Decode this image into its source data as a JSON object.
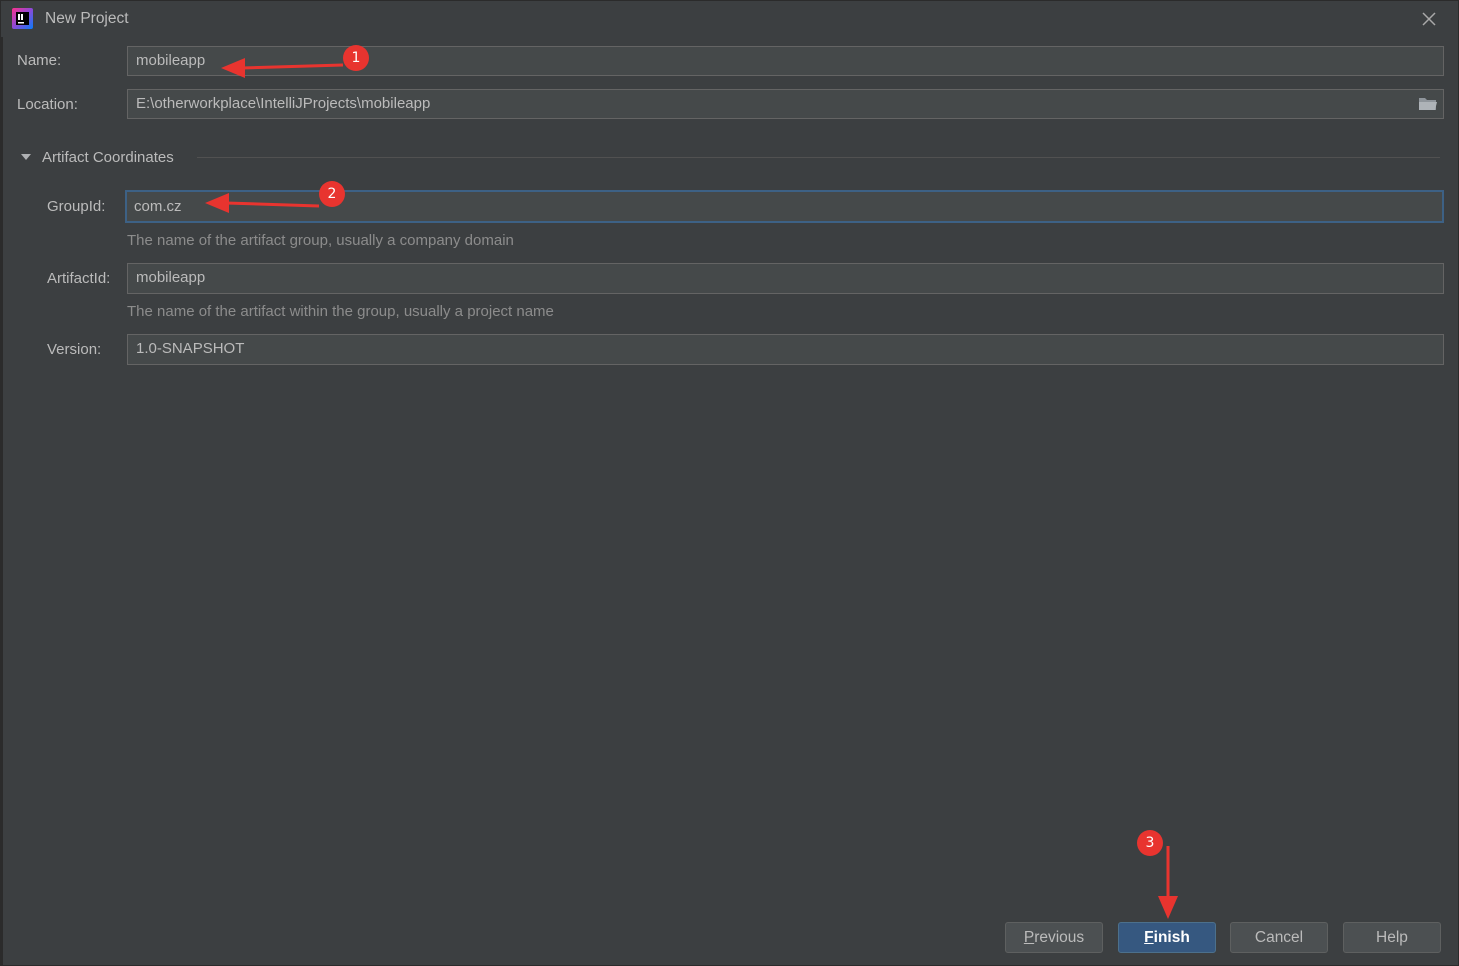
{
  "window": {
    "title": "New Project",
    "close_icon": "close-icon",
    "app_icon": "intellij-idea-icon"
  },
  "form": {
    "name": {
      "label": "Name:",
      "value": "mobileapp"
    },
    "location": {
      "label": "Location:",
      "value": "E:\\otherworkplace\\IntelliJProjects\\mobileapp",
      "icon": "folder-icon"
    }
  },
  "artifact": {
    "section_title": "Artifact Coordinates",
    "expanded": true,
    "group_id": {
      "label": "GroupId:",
      "value": "com.cz",
      "hint": "The name of the artifact group, usually a company domain"
    },
    "artifact_id": {
      "label": "ArtifactId:",
      "value": "mobileapp",
      "hint": "The name of the artifact within the group, usually a project name"
    },
    "version": {
      "label": "Version:",
      "value": "1.0-SNAPSHOT"
    }
  },
  "buttons": {
    "previous": {
      "mnemonic": "P",
      "rest": "revious"
    },
    "finish": {
      "mnemonic": "F",
      "rest": "inish"
    },
    "cancel": "Cancel",
    "help": "Help"
  },
  "annotations": {
    "badge_1": "1",
    "badge_2": "2",
    "badge_3": "3",
    "color": "#e8342f"
  },
  "colors": {
    "background": "#3c3f41",
    "field_bg": "#45494a",
    "focus_border": "#3d6185",
    "primary_button": "#365880"
  }
}
